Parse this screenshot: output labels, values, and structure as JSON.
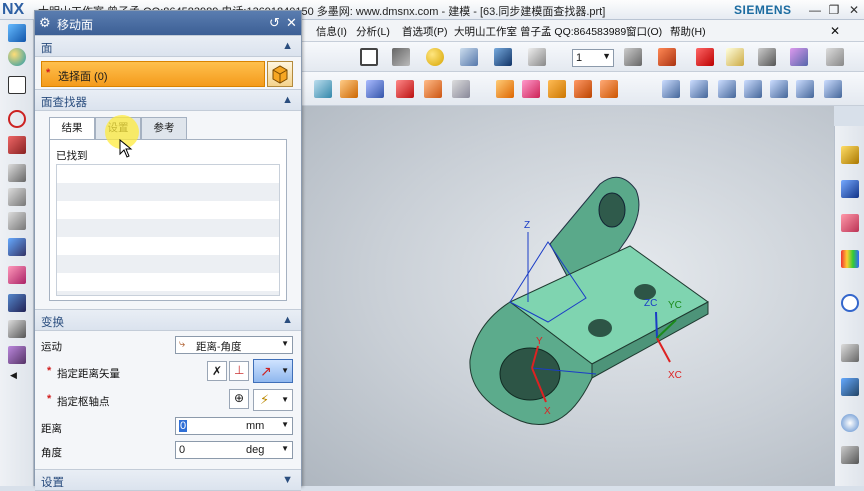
{
  "app": {
    "logo": "NX",
    "window_title": "大明山工作室 曾子孟 QQ:864583989 电话:13691840150 多墨网: www.dmsnx.com - 建模 - [63.同步建模面查找器.prt]",
    "brand": "SIEMENS"
  },
  "menubar": {
    "items": [
      "信息(I)",
      "分析(L)",
      "首选项(P)",
      "大明山工作室",
      "曾子孟 QQ:864583989",
      "窗口(O)",
      "帮助(H)"
    ]
  },
  "toolbar": {
    "layer_value": "1"
  },
  "dialog": {
    "title": "移动面",
    "face_section": "面",
    "select_face": "选择面 (0)",
    "finder_section": "面查找器",
    "tabs": [
      "结果",
      "设置",
      "参考"
    ],
    "found_label": "已找到",
    "transform_section": "变换",
    "motion_label": "运动",
    "motion_value": "距离-角度",
    "dist_vector_label": "指定距离矢量",
    "pivot_label": "指定枢轴点",
    "distance_label": "距离",
    "distance_value": "0",
    "distance_unit": "mm",
    "angle_label": "角度",
    "angle_value": "0",
    "angle_unit": "deg",
    "settings_section": "设置"
  },
  "viewport": {
    "labels": {
      "zc": "ZC",
      "yc": "YC",
      "xc": "XC",
      "z": "Z",
      "y": "Y",
      "x": "X"
    },
    "model_color": "#6fbf9f"
  }
}
